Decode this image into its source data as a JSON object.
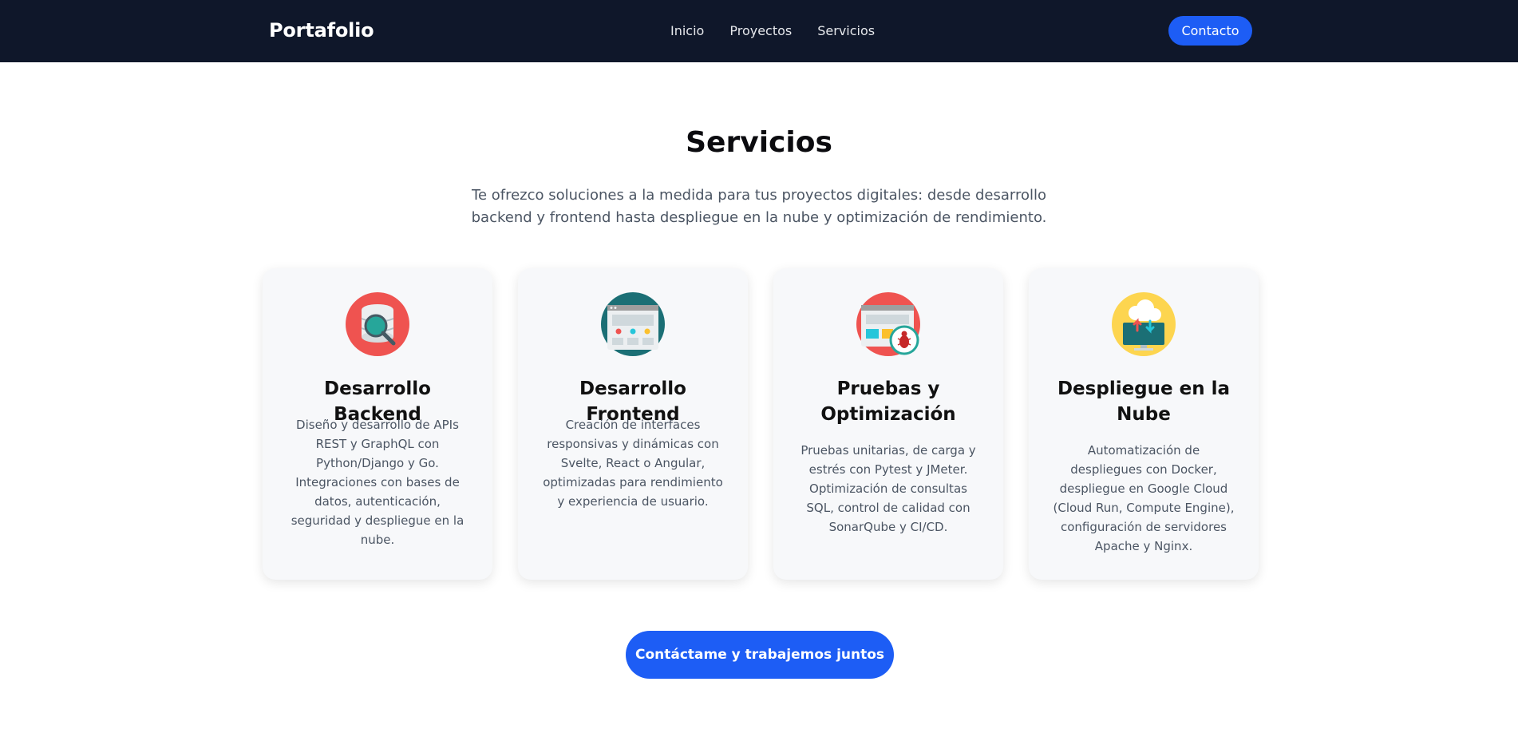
{
  "header": {
    "brand": "Portafolio",
    "nav": [
      "Inicio",
      "Proyectos",
      "Servicios"
    ],
    "contact_button": "Contacto"
  },
  "section": {
    "title": "Servicios",
    "subtitle": "Te ofrezco soluciones a la medida para tus proyectos digitales: desde desarrollo backend y frontend hasta despliegue en la nube y optimización de rendimiento."
  },
  "cards": [
    {
      "icon": "database-search-icon",
      "title": "Desarrollo Backend",
      "description": "Diseño y desarrollo de APIs REST y GraphQL con Python/Django y Go. Integraciones con bases de datos, autenticación, seguridad y despliegue en la nube."
    },
    {
      "icon": "web-interface-icon",
      "title": "Desarrollo Frontend",
      "description": "Creación de interfaces responsivas y dinámicas con Svelte, React o Angular, optimizadas para rendimiento y experiencia de usuario."
    },
    {
      "icon": "bug-testing-icon",
      "title": "Pruebas y Optimización",
      "description": "Pruebas unitarias, de carga y estrés con Pytest y JMeter. Optimización de consultas SQL, control de calidad con SonarQube y CI/CD."
    },
    {
      "icon": "cloud-deploy-icon",
      "title": "Despliegue en la Nube",
      "description": "Automatización de despliegues con Docker, despliegue en Google Cloud (Cloud Run, Compute Engine), configuración de servidores Apache y Nginx."
    }
  ],
  "cta": {
    "label": "Contáctame y trabajemos juntos"
  },
  "colors": {
    "navbar": "#0f172a",
    "accent": "#1d5df5",
    "card_bg": "#f7f8fa"
  }
}
